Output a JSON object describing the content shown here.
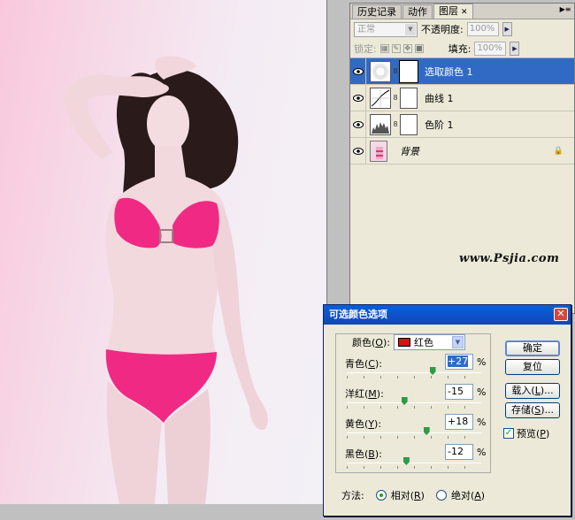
{
  "layers_panel": {
    "tabs": [
      "历史记录",
      "动作",
      "图层"
    ],
    "active_tab": "图层",
    "blend_mode": "正常",
    "opacity_label": "不透明度:",
    "opacity_value": "100%",
    "lock_label": "锁定:",
    "fill_label": "填充:",
    "fill_value": "100%",
    "layers": [
      {
        "name": "选取颜色 1",
        "type": "adjustment-selective-color",
        "selected": true
      },
      {
        "name": "曲线 1",
        "type": "adjustment-curves",
        "selected": false
      },
      {
        "name": "色阶 1",
        "type": "adjustment-levels",
        "selected": false
      },
      {
        "name": "背景",
        "type": "background",
        "selected": false
      }
    ]
  },
  "watermark": "www.Psjia.com",
  "dialog": {
    "title": "可选颜色选项",
    "color_label": "颜色(",
    "color_key": "O",
    "color_value": "红色",
    "swatch_color": "#d81010",
    "sliders": [
      {
        "label": "青色(",
        "key": "C",
        "value": "+27",
        "fraction": 0.635
      },
      {
        "label": "洋红(",
        "key": "M",
        "value": "-15",
        "fraction": 0.425
      },
      {
        "label": "黄色(",
        "key": "Y",
        "value": "+18",
        "fraction": 0.59
      },
      {
        "label": "黑色(",
        "key": "B",
        "value": "-12",
        "fraction": 0.44
      }
    ],
    "percent": "%",
    "buttons": {
      "ok": "确定",
      "reset": "复位",
      "load": "载入(",
      "load_key": "L",
      "save": "存储(",
      "save_key": "S",
      "ellipsis": ")..."
    },
    "preview_label": "预览(",
    "preview_key": "P",
    "preview_checked": true,
    "method_label": "方法:",
    "relative_label": "相对(",
    "relative_key": "R",
    "absolute_label": "绝对(",
    "absolute_key": "A",
    "method_selected": "relative"
  }
}
